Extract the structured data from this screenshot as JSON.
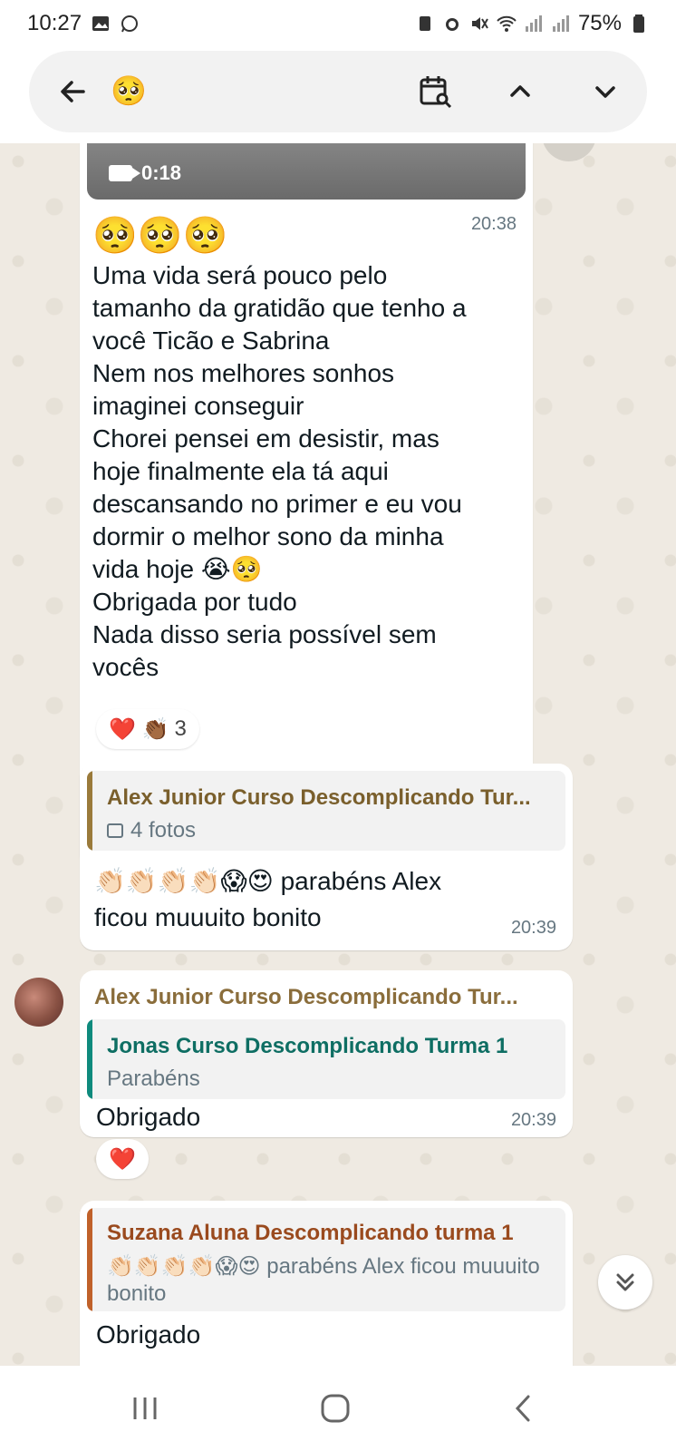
{
  "status_bar": {
    "time": "10:27",
    "battery": "75%"
  },
  "search": {
    "query": "🥺"
  },
  "messages": {
    "m1": {
      "video_duration": "0:18",
      "emojis": "🥺🥺🥺",
      "time": "20:38",
      "text": "Uma vida será pouco pelo\ntamanho da gratidão que tenho a\nvocê Ticão e Sabrina\nNem nos melhores sonhos\nimaginei conseguir\nChorei pensei em desistir, mas\nhoje finalmente ela tá aqui\ndescansando no primer e eu vou\ndormir o melhor sono da minha\nvida hoje 😭🥺\nObrigada por tudo\nNada disso seria possível sem\nvocês",
      "reactions": "❤️ 👏🏾",
      "reaction_count": "3"
    },
    "m2": {
      "quote_name": "Alex Junior Curso Descomplicando Tur...",
      "quote_sub": "4 fotos",
      "text": "👏🏻👏🏻👏🏻👏🏻😱😍 parabéns Alex\nficou muuuito bonito",
      "time": "20:39"
    },
    "m3": {
      "sender": "Alex Junior Curso Descomplicando Tur...",
      "quote_name": "Jonas Curso Descomplicando Turma 1",
      "quote_sub": "Parabéns",
      "text": "Obrigado",
      "time": "20:39",
      "reactions": "❤️"
    },
    "m4": {
      "quote_name": "Suzana Aluna Descomplicando turma 1",
      "quote_sub": "👏🏻👏🏻👏🏻👏🏻😱😍 parabéns Alex ficou muuuito bonito",
      "text": "Obrigado"
    }
  },
  "colors": {
    "chat_bg": "#efeae2",
    "quote_bar_1": "#9a7a3a",
    "quote_bar_2": "#0e8a7d",
    "quote_bar_3": "#c0612a",
    "sender_color": "#8a6d3b"
  }
}
